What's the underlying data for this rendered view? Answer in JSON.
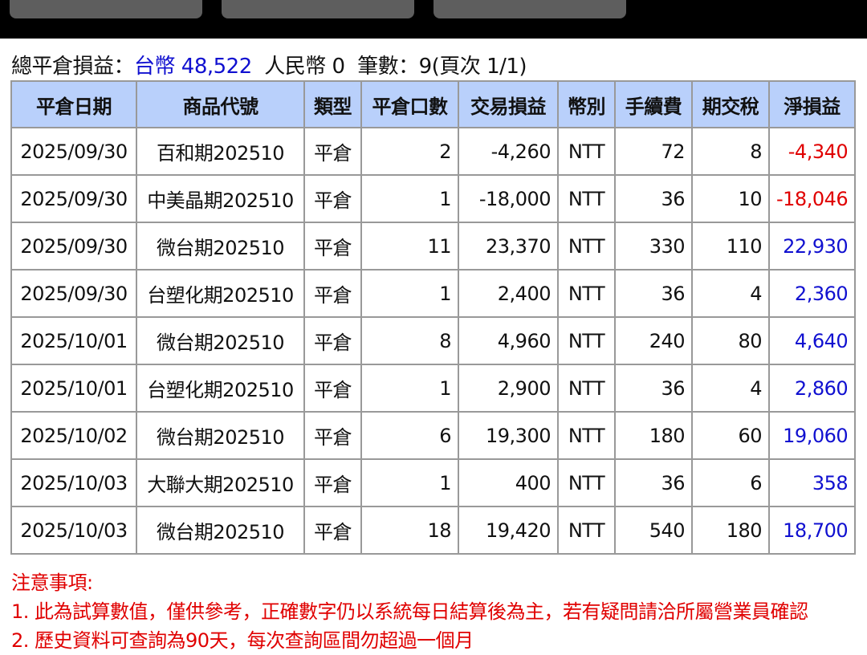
{
  "summary": {
    "label": "總平倉損益：",
    "twd": "台幣 48,522",
    "rmb": "人民幣 0",
    "count": "筆數：9(頁次 1/1)"
  },
  "headers": [
    "平倉日期",
    "商品代號",
    "類型",
    "平倉口數",
    "交易損益",
    "幣別",
    "手續費",
    "期交稅",
    "淨損益"
  ],
  "rows": [
    [
      "2025/09/30",
      "百和期202510",
      "平倉",
      "2",
      "-4,260",
      "NTT",
      "72",
      "8",
      "-4,340"
    ],
    [
      "2025/09/30",
      "中美晶期202510",
      "平倉",
      "1",
      "-18,000",
      "NTT",
      "36",
      "10",
      "-18,046"
    ],
    [
      "2025/09/30",
      "微台期202510",
      "平倉",
      "11",
      "23,370",
      "NTT",
      "330",
      "110",
      "22,930"
    ],
    [
      "2025/09/30",
      "台塑化期202510",
      "平倉",
      "1",
      "2,400",
      "NTT",
      "36",
      "4",
      "2,360"
    ],
    [
      "2025/10/01",
      "微台期202510",
      "平倉",
      "8",
      "4,960",
      "NTT",
      "240",
      "80",
      "4,640"
    ],
    [
      "2025/10/01",
      "台塑化期202510",
      "平倉",
      "1",
      "2,900",
      "NTT",
      "36",
      "4",
      "2,860"
    ],
    [
      "2025/10/02",
      "微台期202510",
      "平倉",
      "6",
      "19,300",
      "NTT",
      "180",
      "60",
      "19,060"
    ],
    [
      "2025/10/03",
      "大聯大期202510",
      "平倉",
      "1",
      "400",
      "NTT",
      "36",
      "6",
      "358"
    ],
    [
      "2025/10/03",
      "微台期202510",
      "平倉",
      "18",
      "19,420",
      "NTT",
      "540",
      "180",
      "18,700"
    ]
  ],
  "notes": {
    "title": "注意事項:",
    "line1": "1. 此為試算數值，僅供參考，正確數字仍以系統每日結算後為主，若有疑問請洽所屬營業員確認",
    "line2": "2. 歷史資料可查詢為90天，每次查詢區間勿超過一個月"
  },
  "colors": {
    "header_bg": "#b9d0fb",
    "negative": "#e00000",
    "positive": "#1010d0"
  }
}
